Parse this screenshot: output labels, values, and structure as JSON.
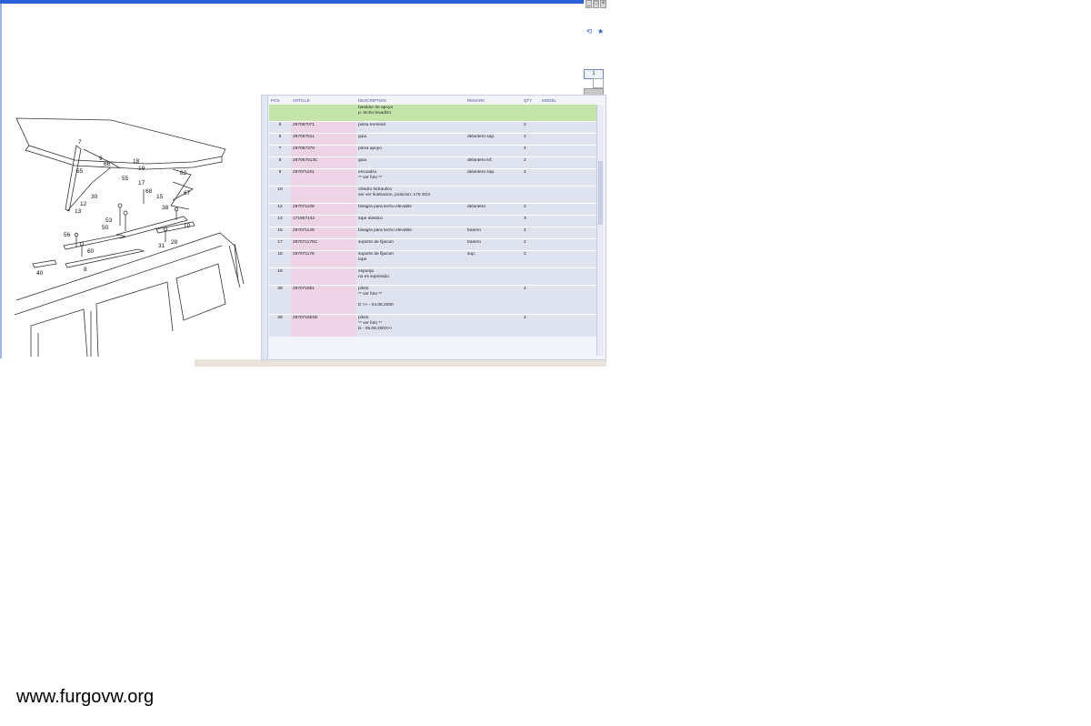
{
  "window": {
    "buttons": [
      "_",
      "□",
      "×"
    ],
    "nav_icons": [
      "⟲",
      "★"
    ],
    "frame_color": "#2a5fd6"
  },
  "scroll_widget_label": "1",
  "diagram": {
    "part_numbers": [
      "7",
      "65",
      "9",
      "66",
      "18",
      "19",
      "62",
      "55",
      "17",
      "68",
      "15",
      "67",
      "12",
      "13",
      "30",
      "53",
      "50",
      "10",
      "38",
      "56",
      "60",
      "31",
      "28",
      "40",
      "8"
    ]
  },
  "table": {
    "headers": {
      "pos": "POS",
      "article": "ARTICLE",
      "description": "DESCRIPTION",
      "remark": "REMARK",
      "qty": "QTY",
      "model": "MODEL"
    },
    "rows": [
      {
        "type": "section",
        "pos": "",
        "article": "",
        "desc": [
          "bastidor de apoyo",
          "p. techo levadizo"
        ],
        "remark": "",
        "qty": ""
      },
      {
        "type": "row",
        "pos": "5",
        "article": "297067071",
        "desc": [
          "pieza terminal"
        ],
        "remark": "",
        "qty": "2"
      },
      {
        "type": "row",
        "pos": "6",
        "article": "297067511",
        "desc": [
          "guia"
        ],
        "remark": "delantero sup.",
        "qty": "2"
      },
      {
        "type": "row",
        "pos": "7",
        "article": "297067370",
        "desc": [
          "pieza apoyo"
        ],
        "remark": "",
        "qty": "4"
      },
      {
        "type": "row",
        "pos": "8",
        "article": "297067513C",
        "desc": [
          "guia"
        ],
        "remark": "delantero inf.",
        "qty": "2"
      },
      {
        "type": "row",
        "pos": "9",
        "article": "297071161",
        "desc": [
          "escuadra",
          "** ver foto **"
        ],
        "remark": "delantero sup.",
        "qty": "2"
      },
      {
        "type": "row",
        "pos": "10",
        "article": "",
        "desc": [
          "cilindro hidraulico",
          "ver ver ilustracion, posicion: 175 3G3"
        ],
        "remark": "",
        "qty": ""
      },
      {
        "type": "row",
        "pos": "12",
        "article": "297071109",
        "desc": [
          "bisagra para techo elevable"
        ],
        "remark": "delantero",
        "qty": "2"
      },
      {
        "type": "row",
        "pos": "13",
        "article": "171857143",
        "desc": [
          "tope elastico"
        ],
        "remark": "",
        "qty": "X"
      },
      {
        "type": "row",
        "pos": "15",
        "article": "297071149",
        "desc": [
          "bisagra para techo elevable"
        ],
        "remark": "trasero",
        "qty": "2"
      },
      {
        "type": "row",
        "pos": "17",
        "article": "297071175C",
        "desc": [
          "soporte de fijacion"
        ],
        "remark": "trasero",
        "qty": "2"
      },
      {
        "type": "row",
        "pos": "18",
        "article": "297071176",
        "desc": [
          "soporte de fijacion",
          "tope"
        ],
        "remark": "sup.",
        "qty": "2"
      },
      {
        "type": "row",
        "pos": "19",
        "article": "",
        "desc": [
          "esponja",
          "no es suprimido"
        ],
        "remark": "",
        "qty": ""
      },
      {
        "type": "row",
        "pos": "28",
        "article": "297071851",
        "desc": [
          "piloto",
          "** ver foto **",
          "",
          "D        >> - 04.08.2000"
        ],
        "remark": "",
        "qty": "4"
      },
      {
        "type": "row",
        "pos": "28",
        "article": "297071851B",
        "desc": [
          "piloto",
          "** ver foto **",
          "D - 05.08.2000>>"
        ],
        "remark": "",
        "qty": "4"
      }
    ]
  },
  "watermark": "www.furgovw.org"
}
